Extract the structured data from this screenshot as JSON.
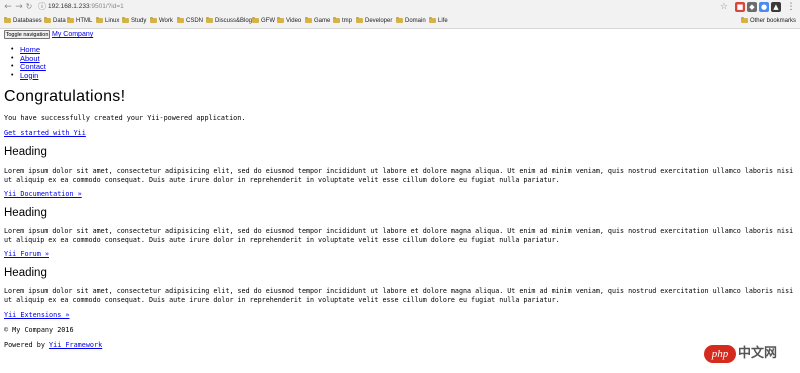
{
  "browser": {
    "back_icon": "←",
    "forward_icon": "→",
    "reload_icon": "↻",
    "url_host": "192.168.1.233",
    "url_rest": ":9501/?id=1",
    "bookmarks": [
      {
        "label": "Databases"
      },
      {
        "label": "Data"
      },
      {
        "label": "HTML"
      },
      {
        "label": "Linux"
      },
      {
        "label": "Study"
      },
      {
        "label": "Work"
      },
      {
        "label": "CSDN"
      },
      {
        "label": "Discuss&Blog"
      },
      {
        "label": "GFW"
      },
      {
        "label": "Video"
      },
      {
        "label": "Game"
      },
      {
        "label": "tmp"
      },
      {
        "label": "Developer"
      },
      {
        "label": "Domain"
      },
      {
        "label": "Life"
      }
    ],
    "other_bookmarks": "Other bookmarks"
  },
  "navbar": {
    "toggle_label": "Toggle navigation",
    "brand": "My Company",
    "items": [
      "Home",
      "About",
      "Contact",
      "Login"
    ]
  },
  "jumbotron": {
    "title": "Congratulations!",
    "lead": "You have successfully created your Yii-powered application.",
    "cta": "Get started with Yii"
  },
  "sections": [
    {
      "heading": "Heading",
      "body_line1": "Lorem ipsum dolor sit amet, consectetur adipisicing elit, sed do eiusmod tempor incididunt ut labore et dolore magna aliqua. Ut enim ad minim veniam, quis nostrud exercitation ullamco laboris nisi",
      "body_line2": "ut aliquip ex ea commodo consequat. Duis aute irure dolor in reprehenderit in voluptate velit esse cillum dolore eu fugiat nulla pariatur.",
      "link": "Yii Documentation »"
    },
    {
      "heading": "Heading",
      "body_line1": "Lorem ipsum dolor sit amet, consectetur adipisicing elit, sed do eiusmod tempor incididunt ut labore et dolore magna aliqua. Ut enim ad minim veniam, quis nostrud exercitation ullamco laboris nisi",
      "body_line2": "ut aliquip ex ea commodo consequat. Duis aute irure dolor in reprehenderit in voluptate velit esse cillum dolore eu fugiat nulla pariatur.",
      "link": "Yii Forum »"
    },
    {
      "heading": "Heading",
      "body_line1": "Lorem ipsum dolor sit amet, consectetur adipisicing elit, sed do eiusmod tempor incididunt ut labore et dolore magna aliqua. Ut enim ad minim veniam, quis nostrud exercitation ullamco laboris nisi",
      "body_line2": "ut aliquip ex ea commodo consequat. Duis aute irure dolor in reprehenderit in voluptate velit esse cillum dolore eu fugiat nulla pariatur.",
      "link": "Yii Extensions »"
    }
  ],
  "footer": {
    "copyright": "© My Company 2016",
    "powered_prefix": "Powered by ",
    "powered_link": "Yii Framework"
  },
  "watermark": {
    "badge": "php",
    "text": "中文网"
  },
  "colors": {
    "link": "#0000ee",
    "chrome_bg": "#f2f2f2",
    "folder": "#d4b44a",
    "watermark_red": "#d52b1e"
  }
}
